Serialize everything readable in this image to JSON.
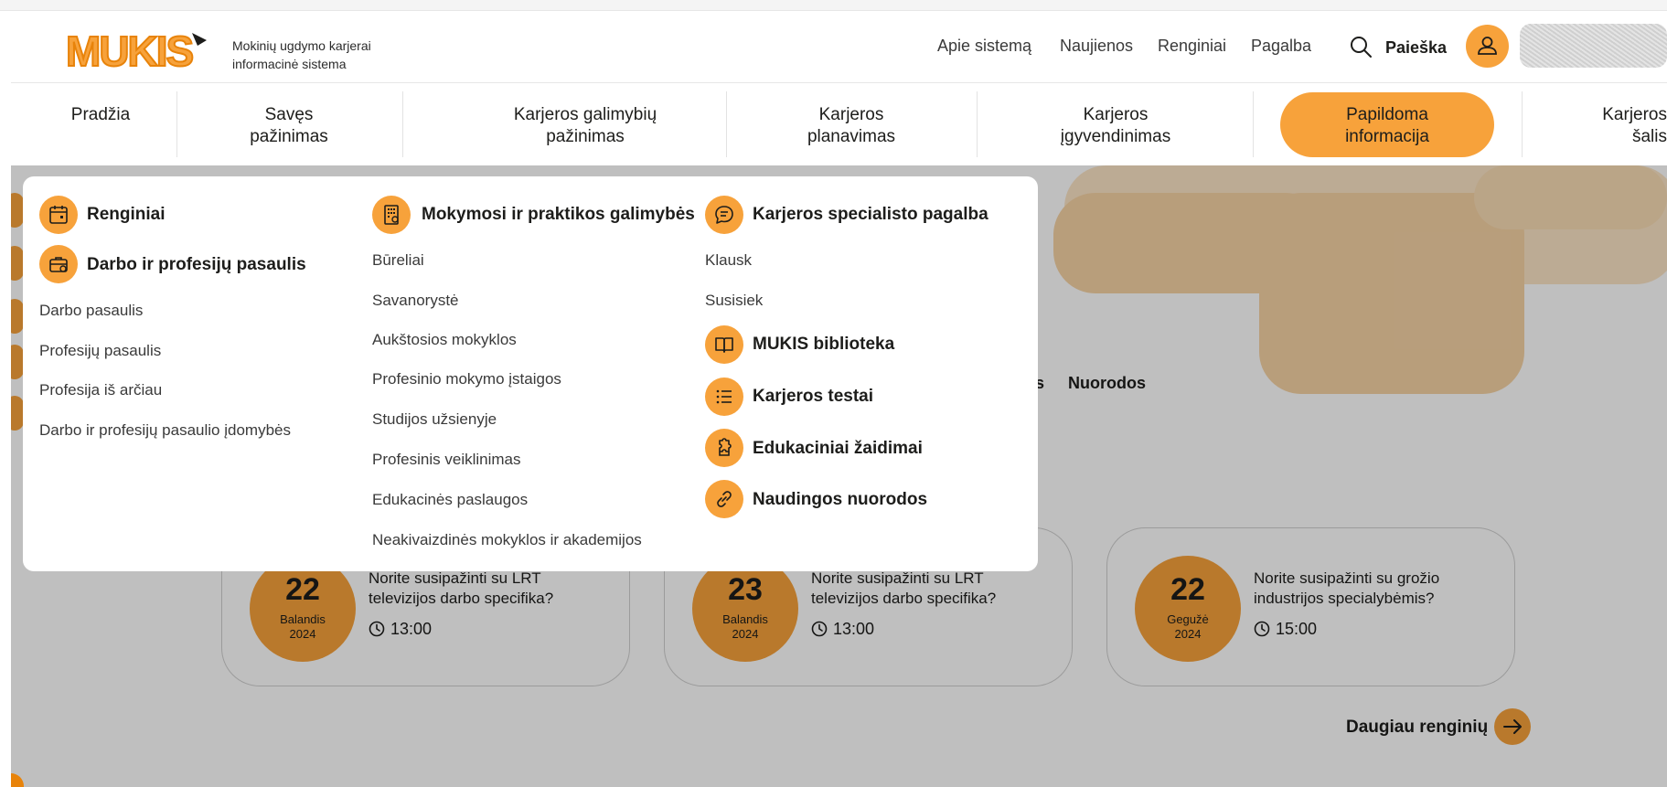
{
  "header": {
    "logo_text": "MUKIS",
    "tagline_line1": "Mokinių ugdymo karjerai",
    "tagline_line2": "informacinė sistema",
    "links": [
      "Apie sistemą",
      "Naujienos",
      "Renginiai",
      "Pagalba"
    ],
    "search_label": "Paieška"
  },
  "nav": {
    "items": [
      {
        "line1": "Pradžia",
        "line2": ""
      },
      {
        "line1": "Savęs",
        "line2": "pažinimas"
      },
      {
        "line1": "Karjeros galimybių",
        "line2": "pažinimas"
      },
      {
        "line1": "Karjeros",
        "line2": "planavimas"
      },
      {
        "line1": "Karjeros",
        "line2": "įgyvendinimas"
      },
      {
        "line1": "Papildoma",
        "line2": "informacija"
      },
      {
        "line1": "Karjeros",
        "line2": "šalis"
      }
    ],
    "active_index": 5
  },
  "dropdown": {
    "col1": {
      "heading_events": "Renginiai",
      "heading_world": "Darbo ir profesijų pasaulis",
      "links": [
        "Darbo pasaulis",
        "Profesijų pasaulis",
        "Profesija iš arčiau",
        "Darbo ir profesijų pasaulio įdomybės"
      ]
    },
    "col2": {
      "heading": "Mokymosi ir praktikos galimybės",
      "links": [
        "Būreliai",
        "Savanorystė",
        "Aukštosios mokyklos",
        "Profesinio mokymo įstaigos",
        "Studijos užsienyje",
        "Profesinis veiklinimas",
        "Edukacinės paslaugos",
        "Neakivaizdinės mokyklos ir akademijos"
      ]
    },
    "col3": {
      "heading": "Karjeros specialisto pagalba",
      "links": [
        "Klausk",
        "Susisiek"
      ],
      "sections": [
        "MUKIS biblioteka",
        "Karjeros testai",
        "Edukaciniai žaidimai",
        "Naudingos nuorodos"
      ]
    }
  },
  "background": {
    "link_fragment": "s",
    "link_nuorodos": "Nuorodos",
    "events": [
      {
        "day": "22",
        "month": "Balandis",
        "year": "2024",
        "title": "Norite susipažinti su LRT televizijos darbo specifika?",
        "time": "13:00"
      },
      {
        "day": "23",
        "month": "Balandis",
        "year": "2024",
        "title": "Norite susipažinti su LRT televizijos darbo specifika?",
        "time": "13:00"
      },
      {
        "day": "22",
        "month": "Gegužė",
        "year": "2024",
        "title": "Norite susipažinti su grožio industrijos specialybėmis?",
        "time": "15:00"
      }
    ],
    "more_events": "Daugiau renginių"
  },
  "colors": {
    "accent": "#f7a23b",
    "accent_dark": "#e8830a",
    "text": "#1d1d1b",
    "deco": "#fbe4c6"
  },
  "icons": {
    "events": "calendar-icon",
    "world": "briefcase-icon",
    "learning": "building-icon",
    "specialist": "chat-icon",
    "library": "book-icon",
    "tests": "list-icon",
    "games": "puzzle-icon",
    "links": "link-icon",
    "search": "search-icon",
    "user": "user-icon",
    "more": "arrow-right-icon",
    "time": "clock-icon"
  }
}
